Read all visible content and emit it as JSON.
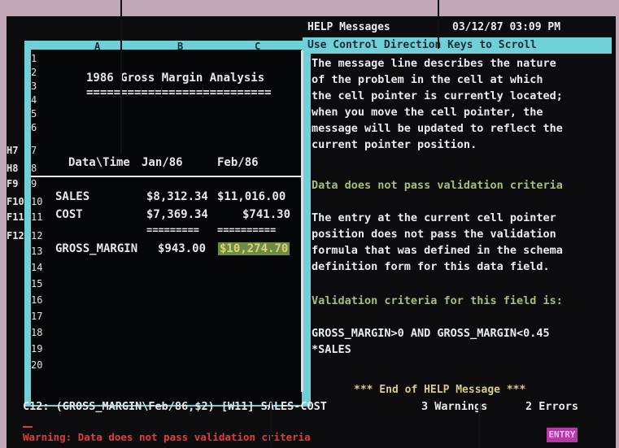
{
  "help": {
    "title": "HELP Messages",
    "datetime": "03/12/87 03:09 PM",
    "scroll_hint": "Use Control Direction Keys to Scroll",
    "para1": [
      "The message line describes the nature",
      "of the problem in the cell at which",
      "the cell pointer is currently located;",
      "when you move the cell pointer, the",
      "message will be updated to reflect the",
      "current pointer position."
    ],
    "header2": "Data does not pass validation criteria",
    "para2": [
      "The entry at the current cell pointer",
      "position does not pass the validation",
      "formula that was defined in the schema",
      "definition form for this data field."
    ],
    "header3": "Validation criteria for this field is:",
    "criteria": [
      "GROSS_MARGIN>0 AND GROSS_MARGIN<0.45",
      "*SALES"
    ],
    "end": "*** End of HELP Message ***"
  },
  "sheet": {
    "columns": [
      "A",
      "B",
      "C"
    ],
    "rows": [
      "1",
      "2",
      "3",
      "4",
      "5",
      "6",
      "7",
      "8",
      "9",
      "10",
      "11",
      "12",
      "13",
      "14",
      "15",
      "16",
      "17",
      "18",
      "19",
      "20"
    ],
    "fkeys": [
      "H7",
      "H8",
      "F9",
      "F10",
      "F11",
      "F12"
    ],
    "title": "1986 Gross Margin Analysis",
    "underline": "===========================",
    "header_label": "Data\\Time",
    "header_b": "Jan/86",
    "header_c": "Feb/86",
    "sales_label": "SALES",
    "sales_b": "$8,312.34",
    "sales_c": "$11,016.00",
    "cost_label": "COST",
    "cost_b": "$7,369.34",
    "cost_c": "$741.30",
    "sep_b": "=========",
    "sep_c": "==========",
    "gm_label": "GROSS_MARGIN",
    "gm_b": "$943.00",
    "gm_c": "$10,274.70"
  },
  "status": {
    "cell_info": "C12: (GROSS_MARGIN\\Feb/86,$2) [W11] SALES-COST",
    "warnings": "3 Warnings",
    "errors": "2 Errors",
    "warning_msg": "Warning: Data does not pass validation criteria",
    "mode": "ENTRY"
  },
  "colors": {
    "frame": "#6fd0d8",
    "background": "#0c0c0e",
    "highlight": "#6f8b42",
    "warning": "#e63a3a",
    "mode": "#b43aa6"
  }
}
